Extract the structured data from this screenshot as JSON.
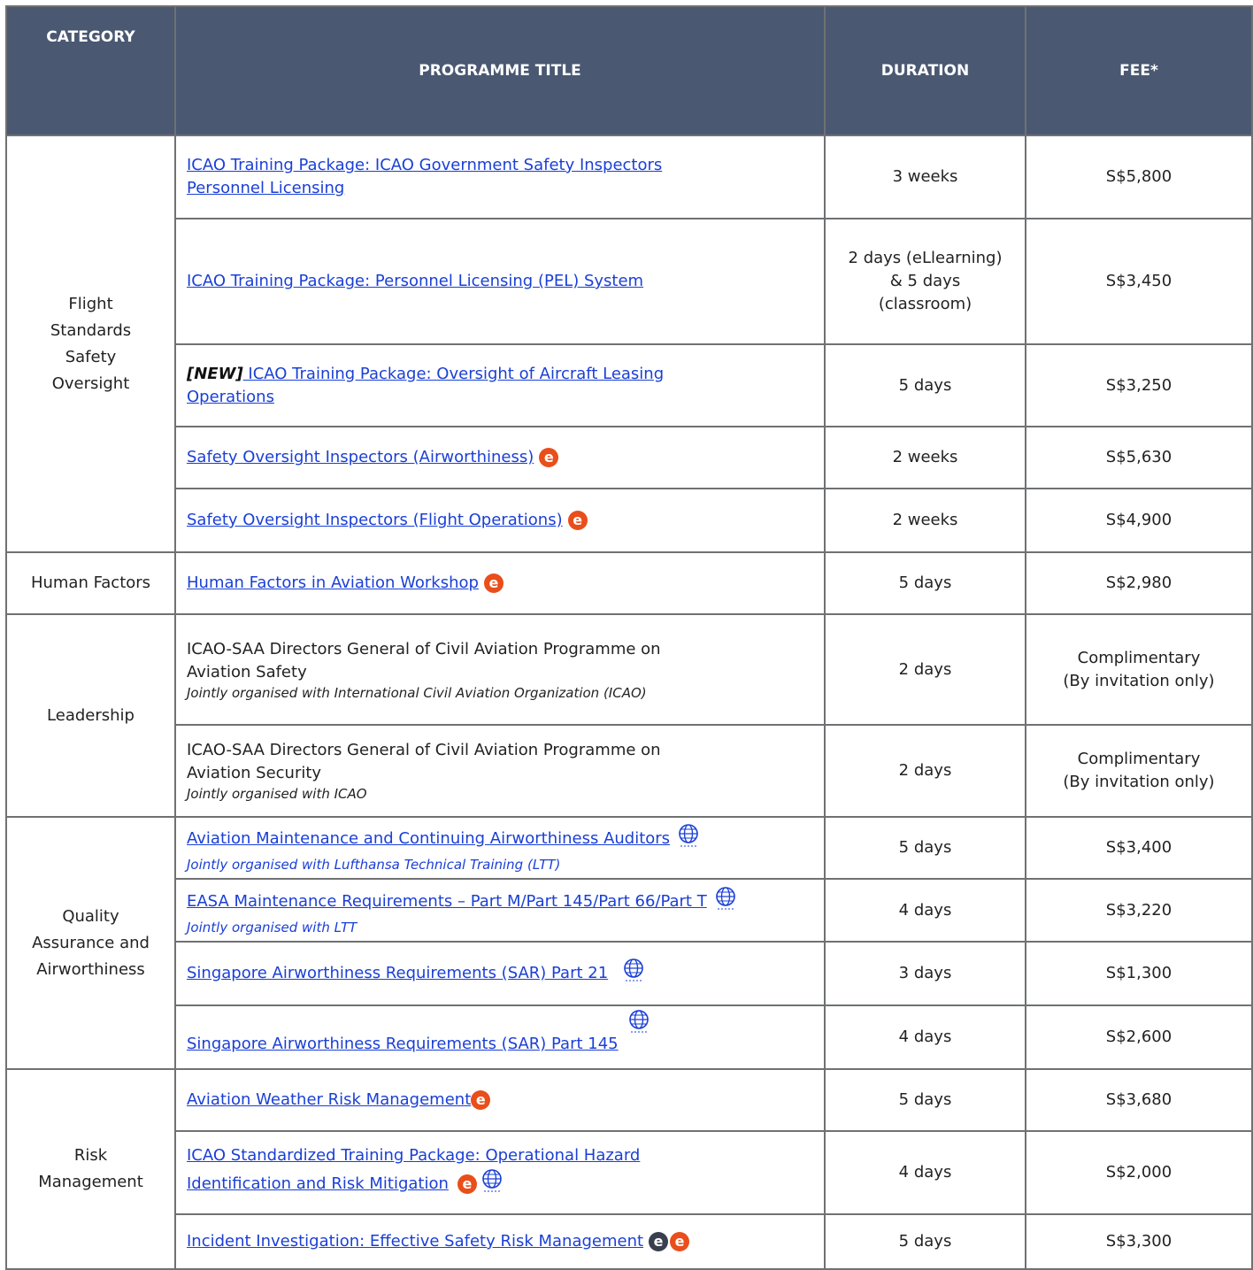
{
  "header": {
    "category": "CATEGORY",
    "title": "PROGRAMME TITLE",
    "duration": "DURATION",
    "fee": "FEE*"
  },
  "categories": {
    "fs_line1": "Flight",
    "fs_line2": "Standards",
    "fs_line3": "Safety",
    "fs_line4": "Oversight",
    "hf": "Human Factors",
    "lead": "Leadership",
    "qa_line1": "Quality",
    "qa_line2": "Assurance and",
    "qa_line3": "Airworthiness",
    "rm_line1": "Risk",
    "rm_line2": "Management"
  },
  "rows": [
    {
      "title_l1": "ICAO Training Package: ICAO Government Safety Inspectors",
      "title_l2": "Personnel Licensing",
      "duration": "3 weeks",
      "fee": "S$5,800"
    },
    {
      "title": "ICAO Training Package: Personnel Licensing (PEL) System",
      "duration_l1": "2 days (eLlearning)",
      "duration_l2": "& 5 days",
      "duration_l3": "(classroom)",
      "fee": "S$3,450"
    },
    {
      "tag": "[NEW]",
      "title_l1": " ICAO Training Package: Oversight of Aircraft Leasing",
      "title_l2": "Operations",
      "duration": "5 days",
      "fee": "S$3,250"
    },
    {
      "title": "Safety Oversight Inspectors (Airworthiness)",
      "duration": "2 weeks",
      "fee": "S$5,630"
    },
    {
      "title": "Safety Oversight Inspectors (Flight Operations)",
      "duration": "2 weeks",
      "fee": "S$4,900"
    },
    {
      "title": "Human Factors in Aviation Workshop",
      "duration": "5 days",
      "fee": "S$2,980"
    },
    {
      "title_l1": "ICAO-SAA Directors General of Civil Aviation Programme on",
      "title_l2": "Aviation Safety",
      "note": "Jointly organised with International Civil Aviation Organization (ICAO)",
      "duration": "2 days",
      "fee_l1": "Complimentary",
      "fee_l2": "(By invitation only)"
    },
    {
      "title_l1": "ICAO-SAA Directors General of Civil Aviation Programme on",
      "title_l2": "Aviation Security",
      "note": "Jointly organised with ICAO",
      "duration": "2 days",
      "fee_l1": "Complimentary",
      "fee_l2": "(By invitation only)"
    },
    {
      "title": "Aviation Maintenance and Continuing Airworthiness Auditors",
      "note": "Jointly organised with Lufthansa Technical Training (LTT)",
      "duration": "5 days",
      "fee": "S$3,400"
    },
    {
      "title": "EASA Maintenance Requirements – Part M/Part 145/Part 66/Part T",
      "note": "Jointly organised with LTT",
      "duration": "4 days",
      "fee": "S$3,220"
    },
    {
      "title": "Singapore Airworthiness Requirements (SAR) Part 21",
      "duration": "3 days",
      "fee": "S$1,300"
    },
    {
      "title": "Singapore Airworthiness Requirements (SAR) Part 145",
      "duration": "4 days",
      "fee": "S$2,600"
    },
    {
      "title": "Aviation Weather Risk Management",
      "duration": "5 days",
      "fee": "S$3,680"
    },
    {
      "title_l1": "ICAO Standardized Training Package: Operational Hazard",
      "title_l2": "Identification and Risk Mitigation",
      "duration": "4 days",
      "fee": "S$2,000"
    },
    {
      "title": "Incident Investigation: Effective Safety Risk Management",
      "duration": "5 days",
      "fee": "S$3,300"
    }
  ],
  "icons": {
    "elearning": "e",
    "elearning_icon": "elearning-icon",
    "globe_icon": "globe-icon",
    "accent": "#e94e1b",
    "header_bg": "#4a5872",
    "link": "#1a3fd6"
  }
}
